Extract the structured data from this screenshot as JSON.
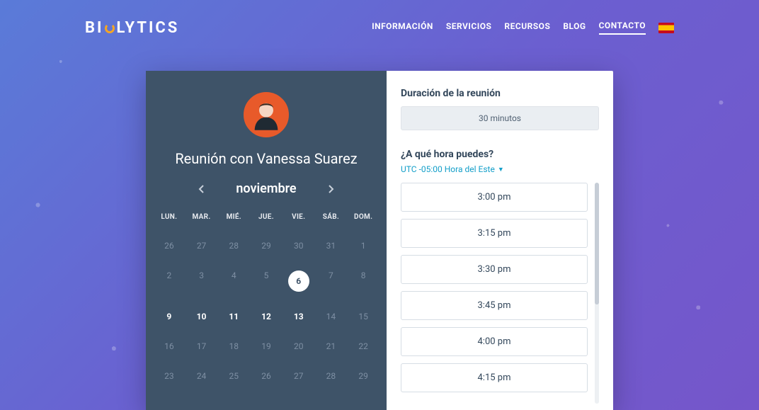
{
  "brand": {
    "pre": "BI",
    "post": "LYTICS"
  },
  "nav": {
    "items": [
      "INFORMACIÓN",
      "SERVICIOS",
      "RECURSOS",
      "BLOG",
      "CONTACTO"
    ],
    "activeIndex": 4
  },
  "meeting": {
    "title": "Reunión con Vanessa Suarez",
    "month": "noviembre"
  },
  "calendar": {
    "dow": [
      "LUN.",
      "MAR.",
      "MIÉ.",
      "JUE.",
      "VIE.",
      "SÁB.",
      "DOM."
    ],
    "weeks": [
      [
        {
          "d": "26",
          "state": "faded"
        },
        {
          "d": "27",
          "state": "faded"
        },
        {
          "d": "28",
          "state": "faded"
        },
        {
          "d": "29",
          "state": "faded"
        },
        {
          "d": "30",
          "state": "faded"
        },
        {
          "d": "31",
          "state": "faded"
        },
        {
          "d": "1",
          "state": "faded"
        }
      ],
      [
        {
          "d": "2",
          "state": "faded"
        },
        {
          "d": "3",
          "state": "faded"
        },
        {
          "d": "4",
          "state": "faded"
        },
        {
          "d": "5",
          "state": "faded"
        },
        {
          "d": "6",
          "state": "selected"
        },
        {
          "d": "7",
          "state": "faded"
        },
        {
          "d": "8",
          "state": "faded"
        }
      ],
      [
        {
          "d": "9",
          "state": "strong"
        },
        {
          "d": "10",
          "state": "strong"
        },
        {
          "d": "11",
          "state": "strong"
        },
        {
          "d": "12",
          "state": "strong"
        },
        {
          "d": "13",
          "state": "strong"
        },
        {
          "d": "14",
          "state": "faded"
        },
        {
          "d": "15",
          "state": "faded"
        }
      ],
      [
        {
          "d": "16",
          "state": "faded"
        },
        {
          "d": "17",
          "state": "faded"
        },
        {
          "d": "18",
          "state": "faded"
        },
        {
          "d": "19",
          "state": "faded"
        },
        {
          "d": "20",
          "state": "faded"
        },
        {
          "d": "21",
          "state": "faded"
        },
        {
          "d": "22",
          "state": "faded"
        }
      ],
      [
        {
          "d": "23",
          "state": "faded"
        },
        {
          "d": "24",
          "state": "faded"
        },
        {
          "d": "25",
          "state": "faded"
        },
        {
          "d": "26",
          "state": "faded"
        },
        {
          "d": "27",
          "state": "faded"
        },
        {
          "d": "28",
          "state": "faded"
        },
        {
          "d": "29",
          "state": "faded"
        }
      ]
    ]
  },
  "right": {
    "durationTitle": "Duración de la reunión",
    "durationValue": "30 minutos",
    "timeQuestion": "¿A qué hora puedes?",
    "timezone": "UTC -05:00 Hora del Este",
    "slots": [
      "3:00 pm",
      "3:15 pm",
      "3:30 pm",
      "3:45 pm",
      "4:00 pm",
      "4:15 pm"
    ]
  }
}
